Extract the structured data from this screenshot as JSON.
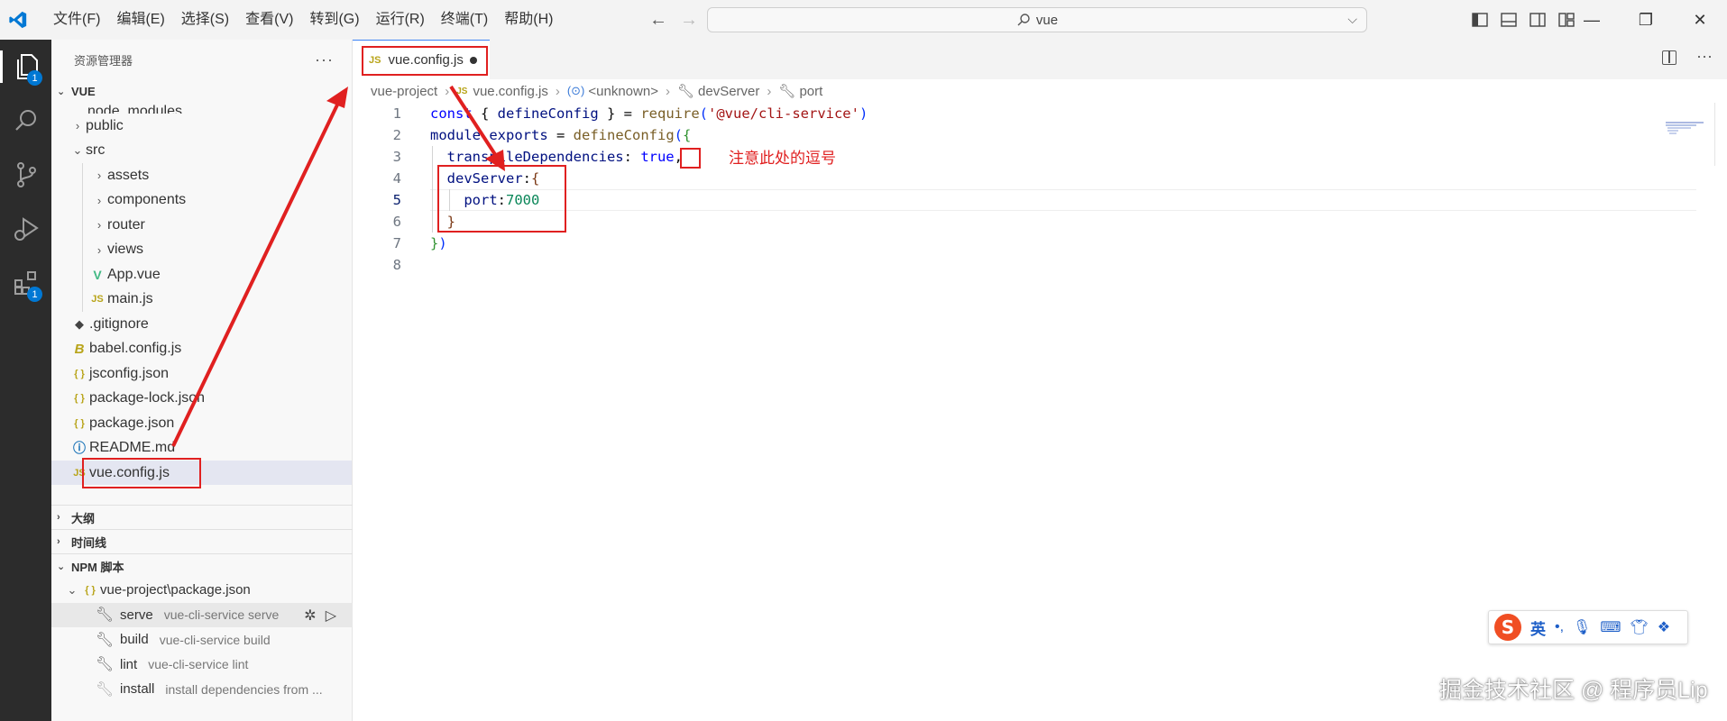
{
  "titlebar": {
    "menu": [
      "文件(F)",
      "编辑(E)",
      "选择(S)",
      "查看(V)",
      "转到(G)",
      "运行(R)",
      "终端(T)",
      "帮助(H)"
    ],
    "search_text": "vue",
    "colors": {
      "accent": "#0078d4",
      "annotation": "#e02020"
    }
  },
  "activity": {
    "explorer_badge": "1",
    "extensions_badge": "1"
  },
  "sidebar": {
    "title": "资源管理器",
    "more": "···",
    "root_folder": "VUE",
    "tree": [
      {
        "label": "node_modules"
      },
      {
        "label": "public"
      },
      {
        "label": "src"
      },
      {
        "label": "assets"
      },
      {
        "label": "components"
      },
      {
        "label": "router"
      },
      {
        "label": "views"
      },
      {
        "label": "App.vue"
      },
      {
        "label": "main.js"
      },
      {
        "label": ".gitignore"
      },
      {
        "label": "babel.config.js"
      },
      {
        "label": "jsconfig.json"
      },
      {
        "label": "package-lock.json"
      },
      {
        "label": "package.json"
      },
      {
        "label": "README.md"
      },
      {
        "label": "vue.config.js"
      }
    ],
    "outline_title": "大纲",
    "timeline_title": "时间线",
    "npm_title": "NPM 脚本",
    "npm_package": "vue-project\\package.json",
    "npm_scripts": [
      {
        "name": "serve",
        "command": "vue-cli-service serve"
      },
      {
        "name": "build",
        "command": "vue-cli-service build"
      },
      {
        "name": "lint",
        "command": "vue-cli-service lint"
      },
      {
        "name": "install",
        "command": "install dependencies from ..."
      }
    ]
  },
  "editor": {
    "tab_label": "vue.config.js",
    "tab_icon": "JS",
    "breadcrumb": [
      "vue-project",
      "vue.config.js",
      "<unknown>",
      "devServer",
      "port"
    ],
    "line_numbers": [
      "1",
      "2",
      "3",
      "4",
      "5",
      "6",
      "7",
      "8"
    ],
    "code": {
      "l1": {
        "kw": "const",
        "a": " { ",
        "id": "defineConfig",
        "b": " } = ",
        "fn": "require",
        "p1": "(",
        "str": "'@vue/cli-service'",
        "p2": ")"
      },
      "l2": {
        "a": "module",
        "b": ".",
        "c": "exports",
        "d": " = ",
        "fn": "defineConfig",
        "p1": "(",
        "p2": "{"
      },
      "l3": {
        "prop": "transpileDependencies",
        "a": ": ",
        "kw": "true",
        "b": ","
      },
      "l4": {
        "prop": "devServer",
        "a": ":",
        "p": "{"
      },
      "l5": {
        "prop": "port",
        "a": ":",
        "num": "7000"
      },
      "l6": {
        "p": "}"
      },
      "l7": {
        "p1": "}",
        "p2": ")"
      }
    }
  },
  "annotation": {
    "note": "注意此处的逗号"
  },
  "ime": {
    "lang": "英",
    "punct": "•,"
  },
  "watermark": "掘金技术社区 @ 程序员Lip"
}
